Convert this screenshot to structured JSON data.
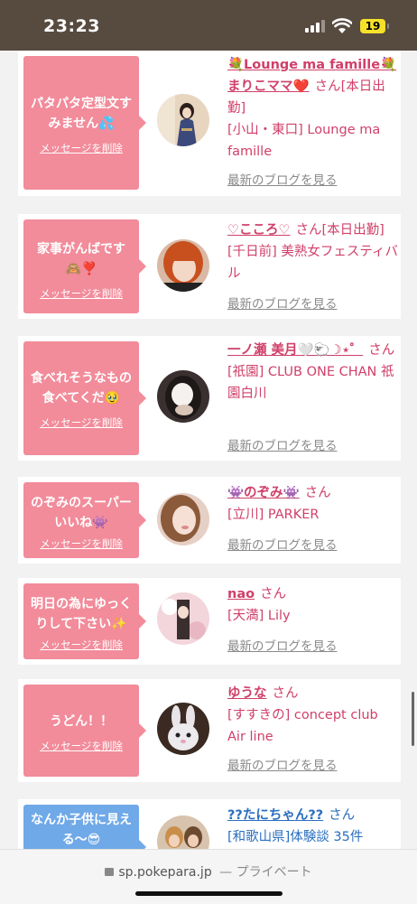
{
  "status": {
    "time": "23:23",
    "battery": "19"
  },
  "cards": [
    {
      "message": "パタパタ定型文すみません💦",
      "delete": "メッセージを削除",
      "name": "💐Lounge ma famille💐まりこママ❤️",
      "san": "さん",
      "status": "[本日出勤]",
      "location": "[小山・東口] Lounge ma famille",
      "blog": "最新のブログを見る"
    },
    {
      "message": "家事がんばです🙈❣️",
      "delete": "メッセージを削除",
      "name": "♡こころ♡",
      "san": "さん",
      "status": "[本日出勤]",
      "location": "[千日前] 美熟女フェスティバル",
      "blog": "最新のブログを見る"
    },
    {
      "message": "食べれそうなもの食べてくだ🥹",
      "delete": "メッセージを削除",
      "name": "一ノ瀬 美月🤍🐑☽⋆゜",
      "san": "さん",
      "status": "",
      "location": "[祇園] CLUB ONE CHAN 祇園白川",
      "blog": "最新のブログを見る"
    },
    {
      "message": "のぞみのスーパーいいね👾",
      "delete": "メッセージを削除",
      "name": "👾のぞみ👾",
      "san": "さん",
      "status": "",
      "location": "[立川] PARKER",
      "blog": "最新のブログを見る"
    },
    {
      "message": "明日の為にゆっくりして下さい✨",
      "delete": "メッセージを削除",
      "name": "nao",
      "san": "さん",
      "status": "",
      "location": "[天満] Lily",
      "blog": "最新のブログを見る"
    },
    {
      "message": "うどん！！",
      "delete": "メッセージを削除",
      "name": "ゆうな",
      "san": "さん",
      "status": "",
      "location": "[すすきの] concept club Air line",
      "blog": "最新のブログを見る"
    },
    {
      "message": "なんか子供に見える〜😎",
      "delete": "",
      "name": "??たにちゃん??",
      "san": "さん",
      "status": "",
      "location": "[和歌山県]体験談 35件",
      "blog": ""
    }
  ],
  "browser": {
    "url": "sp.pokepara.jp",
    "mode": "— プライベート"
  },
  "colors": {
    "accent": "#d0406a",
    "bubble": "#f28b9a",
    "bubble_alt": "#6fa9e8",
    "status_bar": "#574a3f"
  }
}
